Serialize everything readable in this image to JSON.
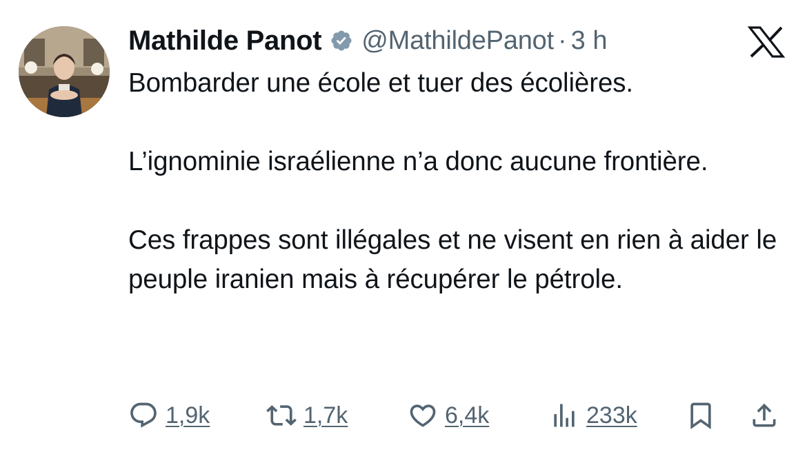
{
  "tweet": {
    "author_name": "Mathilde Panot",
    "handle": "@MathildePanot",
    "separator": "·",
    "time": "3 h",
    "verified_color": "#829aab",
    "paragraphs": [
      "Bombarder une école et tuer des écolières.",
      "L’ignominie israélienne n’a donc aucune frontière.",
      "Ces frappes sont illégales et ne visent en rien à aider le peuple iranien mais à récupérer le pétrole."
    ]
  },
  "actions": {
    "reply_count": "1,9k",
    "retweet_count": "1,7k",
    "like_count": "6,4k",
    "views_count": "233k"
  },
  "icons": {
    "brand": "x-logo-icon",
    "reply": "reply-icon",
    "retweet": "retweet-icon",
    "like": "heart-icon",
    "views": "views-icon",
    "bookmark": "bookmark-icon",
    "share": "share-icon"
  }
}
